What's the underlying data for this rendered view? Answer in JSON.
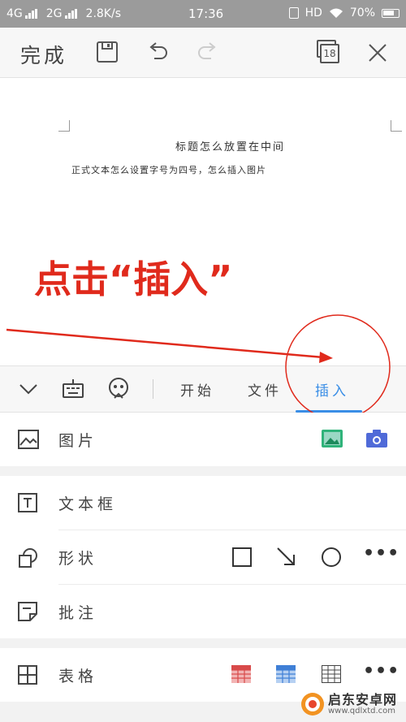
{
  "status_bar": {
    "net1": "4G",
    "net2": "2G",
    "speed": "2.8K/s",
    "time": "17:36",
    "hd": "HD",
    "battery": "70%"
  },
  "toolbar": {
    "done_label": "完成",
    "tabs_count": "18"
  },
  "document": {
    "title": "标题怎么放置在中间",
    "body": "正式文本怎么设置字号为四号，怎么插入图片"
  },
  "annotation": {
    "text": "点击“插入”",
    "color": "#e02a1c"
  },
  "tabbar": {
    "tabs": [
      {
        "label": "开始",
        "active": false
      },
      {
        "label": "文件",
        "active": false
      },
      {
        "label": "插入",
        "active": true
      }
    ],
    "accent": "#3a8ee6"
  },
  "insert_panel": {
    "image": {
      "label": "图片"
    },
    "textbox": {
      "label": "文本框"
    },
    "shape": {
      "label": "形状",
      "more": "•••"
    },
    "comment": {
      "label": "批注"
    },
    "table": {
      "label": "表格",
      "more": "•••"
    }
  },
  "watermark": {
    "brand": "启东安卓网",
    "url": "www.qdlxtd.com"
  },
  "icons": [
    "save-icon",
    "undo-icon",
    "redo-icon",
    "tabs-icon",
    "close-icon",
    "collapse-icon",
    "keyboard-icon",
    "reader-icon",
    "picture-icon",
    "gallery-icon",
    "camera-icon",
    "textbox-icon",
    "shape-icon",
    "square-icon",
    "arrow-icon",
    "circle-icon",
    "comment-icon",
    "table-icon"
  ]
}
